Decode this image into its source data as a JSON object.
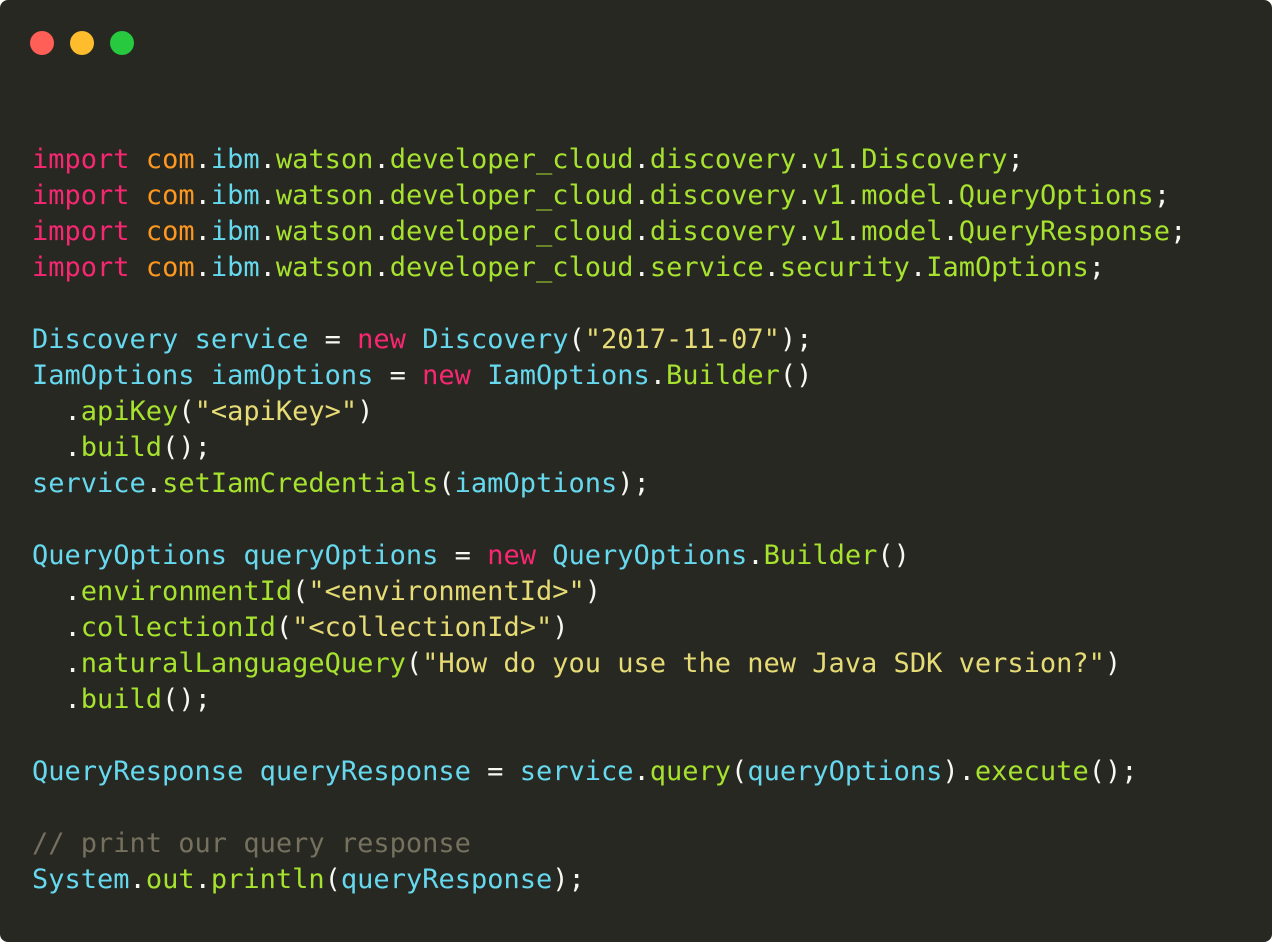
{
  "window": {
    "controls": [
      {
        "name": "close",
        "color": "#ff5f56"
      },
      {
        "name": "minimize",
        "color": "#ffbd2e"
      },
      {
        "name": "maximize",
        "color": "#27c93f"
      }
    ]
  },
  "code": {
    "lines": [
      [
        [
          "kw",
          "import"
        ],
        [
          "op",
          " "
        ],
        [
          "pkg",
          "com"
        ],
        [
          "op",
          "."
        ],
        [
          "pkg2",
          "ibm"
        ],
        [
          "op",
          "."
        ],
        [
          "pkg3",
          "watson"
        ],
        [
          "op",
          "."
        ],
        [
          "pkg3",
          "developer_cloud"
        ],
        [
          "op",
          "."
        ],
        [
          "pkg3",
          "discovery"
        ],
        [
          "op",
          "."
        ],
        [
          "pkg3",
          "v1"
        ],
        [
          "op",
          "."
        ],
        [
          "cls",
          "Discovery"
        ],
        [
          "op",
          ";"
        ]
      ],
      [
        [
          "kw",
          "import"
        ],
        [
          "op",
          " "
        ],
        [
          "pkg",
          "com"
        ],
        [
          "op",
          "."
        ],
        [
          "pkg2",
          "ibm"
        ],
        [
          "op",
          "."
        ],
        [
          "pkg3",
          "watson"
        ],
        [
          "op",
          "."
        ],
        [
          "pkg3",
          "developer_cloud"
        ],
        [
          "op",
          "."
        ],
        [
          "pkg3",
          "discovery"
        ],
        [
          "op",
          "."
        ],
        [
          "pkg3",
          "v1"
        ],
        [
          "op",
          "."
        ],
        [
          "pkg3",
          "model"
        ],
        [
          "op",
          "."
        ],
        [
          "cls",
          "QueryOptions"
        ],
        [
          "op",
          ";"
        ]
      ],
      [
        [
          "kw",
          "import"
        ],
        [
          "op",
          " "
        ],
        [
          "pkg",
          "com"
        ],
        [
          "op",
          "."
        ],
        [
          "pkg2",
          "ibm"
        ],
        [
          "op",
          "."
        ],
        [
          "pkg3",
          "watson"
        ],
        [
          "op",
          "."
        ],
        [
          "pkg3",
          "developer_cloud"
        ],
        [
          "op",
          "."
        ],
        [
          "pkg3",
          "discovery"
        ],
        [
          "op",
          "."
        ],
        [
          "pkg3",
          "v1"
        ],
        [
          "op",
          "."
        ],
        [
          "pkg3",
          "model"
        ],
        [
          "op",
          "."
        ],
        [
          "cls",
          "QueryResponse"
        ],
        [
          "op",
          ";"
        ]
      ],
      [
        [
          "kw",
          "import"
        ],
        [
          "op",
          " "
        ],
        [
          "pkg",
          "com"
        ],
        [
          "op",
          "."
        ],
        [
          "pkg2",
          "ibm"
        ],
        [
          "op",
          "."
        ],
        [
          "pkg3",
          "watson"
        ],
        [
          "op",
          "."
        ],
        [
          "pkg3",
          "developer_cloud"
        ],
        [
          "op",
          "."
        ],
        [
          "pkg3",
          "service"
        ],
        [
          "op",
          "."
        ],
        [
          "pkg3",
          "security"
        ],
        [
          "op",
          "."
        ],
        [
          "cls",
          "IamOptions"
        ],
        [
          "op",
          ";"
        ]
      ],
      [],
      [
        [
          "type",
          "Discovery"
        ],
        [
          "op",
          " "
        ],
        [
          "var",
          "service"
        ],
        [
          "op",
          " = "
        ],
        [
          "kw",
          "new"
        ],
        [
          "op",
          " "
        ],
        [
          "type",
          "Discovery"
        ],
        [
          "op",
          "("
        ],
        [
          "str",
          "\"2017-11-07\""
        ],
        [
          "op",
          ");"
        ]
      ],
      [
        [
          "type",
          "IamOptions"
        ],
        [
          "op",
          " "
        ],
        [
          "var",
          "iamOptions"
        ],
        [
          "op",
          " = "
        ],
        [
          "kw",
          "new"
        ],
        [
          "op",
          " "
        ],
        [
          "type",
          "IamOptions"
        ],
        [
          "op",
          "."
        ],
        [
          "fn",
          "Builder"
        ],
        [
          "op",
          "()"
        ]
      ],
      [
        [
          "op",
          "  ."
        ],
        [
          "fn",
          "apiKey"
        ],
        [
          "op",
          "("
        ],
        [
          "str",
          "\"<apiKey>\""
        ],
        [
          "op",
          ")"
        ]
      ],
      [
        [
          "op",
          "  ."
        ],
        [
          "fn",
          "build"
        ],
        [
          "op",
          "();"
        ]
      ],
      [
        [
          "var",
          "service"
        ],
        [
          "op",
          "."
        ],
        [
          "fn",
          "setIamCredentials"
        ],
        [
          "op",
          "("
        ],
        [
          "var",
          "iamOptions"
        ],
        [
          "op",
          ");"
        ]
      ],
      [],
      [
        [
          "type",
          "QueryOptions"
        ],
        [
          "op",
          " "
        ],
        [
          "var",
          "queryOptions"
        ],
        [
          "op",
          " = "
        ],
        [
          "kw",
          "new"
        ],
        [
          "op",
          " "
        ],
        [
          "type",
          "QueryOptions"
        ],
        [
          "op",
          "."
        ],
        [
          "fn",
          "Builder"
        ],
        [
          "op",
          "()"
        ]
      ],
      [
        [
          "op",
          "  ."
        ],
        [
          "fn",
          "environmentId"
        ],
        [
          "op",
          "("
        ],
        [
          "str",
          "\"<environmentId>\""
        ],
        [
          "op",
          ")"
        ]
      ],
      [
        [
          "op",
          "  ."
        ],
        [
          "fn",
          "collectionId"
        ],
        [
          "op",
          "("
        ],
        [
          "str",
          "\"<collectionId>\""
        ],
        [
          "op",
          ")"
        ]
      ],
      [
        [
          "op",
          "  ."
        ],
        [
          "fn",
          "naturalLanguageQuery"
        ],
        [
          "op",
          "("
        ],
        [
          "str",
          "\"How do you use the new Java SDK version?\""
        ],
        [
          "op",
          ")"
        ]
      ],
      [
        [
          "op",
          "  ."
        ],
        [
          "fn",
          "build"
        ],
        [
          "op",
          "();"
        ]
      ],
      [],
      [
        [
          "type",
          "QueryResponse"
        ],
        [
          "op",
          " "
        ],
        [
          "var",
          "queryResponse"
        ],
        [
          "op",
          " = "
        ],
        [
          "var",
          "service"
        ],
        [
          "op",
          "."
        ],
        [
          "fn",
          "query"
        ],
        [
          "op",
          "("
        ],
        [
          "var",
          "queryOptions"
        ],
        [
          "op",
          ")."
        ],
        [
          "fn",
          "execute"
        ],
        [
          "op",
          "();"
        ]
      ],
      [],
      [
        [
          "cm",
          "// print our query response"
        ]
      ],
      [
        [
          "type",
          "System"
        ],
        [
          "op",
          "."
        ],
        [
          "fn",
          "out"
        ],
        [
          "op",
          "."
        ],
        [
          "fn",
          "println"
        ],
        [
          "op",
          "("
        ],
        [
          "var",
          "queryResponse"
        ],
        [
          "op",
          ");"
        ]
      ]
    ]
  }
}
